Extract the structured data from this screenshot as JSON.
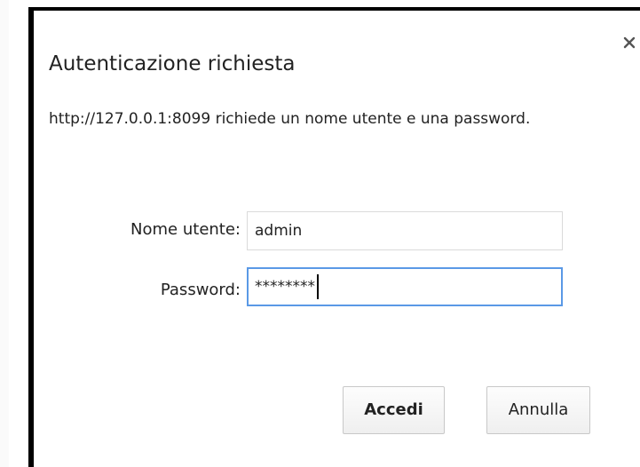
{
  "dialog": {
    "title": "Autenticazione richiesta",
    "message": "http://127.0.0.1:8099 richiede un nome utente e una password.",
    "close_icon": "close-icon"
  },
  "form": {
    "username_label": "Nome utente:",
    "username_value": "admin",
    "password_label": "Password:",
    "password_value": "********"
  },
  "buttons": {
    "submit_label": "Accedi",
    "cancel_label": "Annulla"
  },
  "colors": {
    "focus_border": "#5a99e6",
    "dialog_frame": "#000000"
  }
}
